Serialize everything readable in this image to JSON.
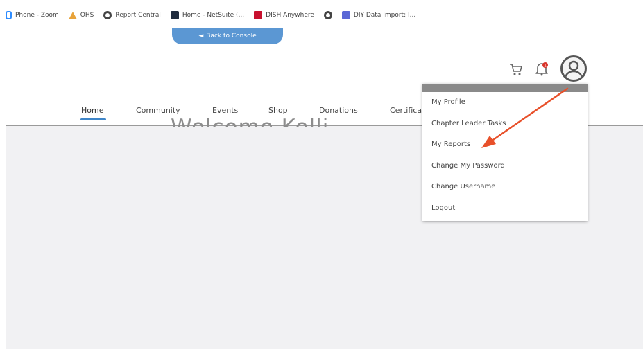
{
  "bookmarks": [
    {
      "label": "Phone - Zoom",
      "icon": "zoom-icon"
    },
    {
      "label": "OHS",
      "icon": "ohs-icon"
    },
    {
      "label": "Report Central",
      "icon": "globe-icon"
    },
    {
      "label": "Home - NetSuite (...",
      "icon": "netsuite-icon"
    },
    {
      "label": "DISH Anywhere",
      "icon": "dish-icon"
    },
    {
      "label": "",
      "icon": "globe-icon"
    },
    {
      "label": "DIY Data Import: I...",
      "icon": "diy-icon"
    }
  ],
  "header": {
    "back_label": "Back to Console",
    "notification_count": "1"
  },
  "nav": {
    "items": [
      "Home",
      "Community",
      "Events",
      "Shop",
      "Donations",
      "Certifica"
    ],
    "active": "Home"
  },
  "main": {
    "welcome": "Welcome Kelli"
  },
  "menu": {
    "items": [
      "My Profile",
      "Chapter Leader Tasks",
      "My Reports",
      "Change My Password",
      "Change Username",
      "Logout"
    ]
  },
  "colors": {
    "accent": "#3f86c9",
    "back_button": "#5b97d3",
    "arrow": "#e8502a",
    "badge": "#d9342b"
  }
}
